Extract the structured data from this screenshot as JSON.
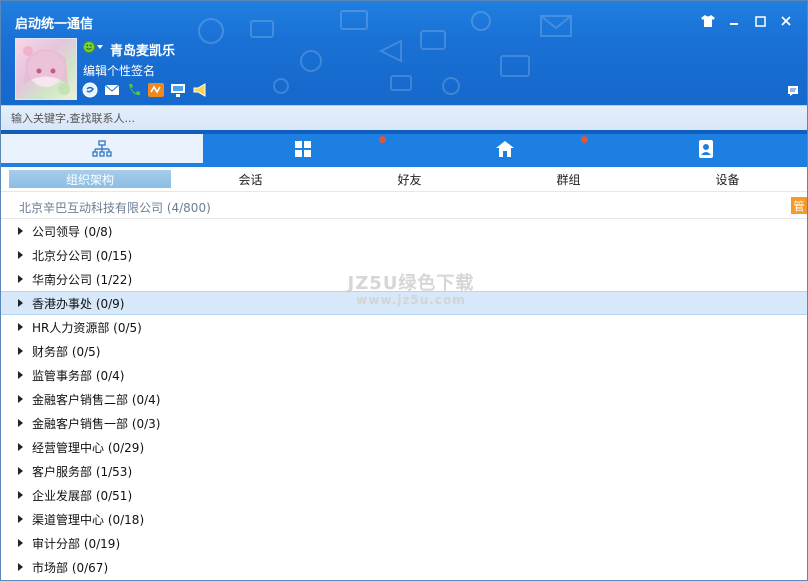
{
  "app": {
    "title": "启动统一通信"
  },
  "profile": {
    "nickname": "青岛麦凯乐",
    "signature": "编辑个性签名"
  },
  "search": {
    "placeholder": "输入关键字,查找联系人..."
  },
  "subtabs": [
    "组织架构",
    "会话",
    "好友",
    "群组",
    "设备"
  ],
  "company": {
    "name": "北京辛巴互动科技有限公司 (4/800)",
    "manage_label": "管"
  },
  "departments": [
    "公司领导 (0/8)",
    "北京分公司 (0/15)",
    "华南分公司 (1/22)",
    "香港办事处 (0/9)",
    "HR人力资源部 (0/5)",
    "财务部 (0/5)",
    "监管事务部 (0/4)",
    "金融客户销售二部 (0/4)",
    "金融客户销售一部 (0/3)",
    "经营管理中心 (0/29)",
    "客户服务部 (1/53)",
    "企业发展部 (0/51)",
    "渠道管理中心 (0/18)",
    "审计分部 (0/19)",
    "市场部 (0/67)"
  ],
  "selected_department": 3,
  "watermark": {
    "line1": "JZ5U绿色下载",
    "line2": "www.jz5u.com"
  },
  "colors": {
    "header": "#1a70d4",
    "tab_bar": "#1e7fe3",
    "selected_row": "#d6e8f9",
    "badge": "#e0563b",
    "manage": "#f39a2b"
  }
}
